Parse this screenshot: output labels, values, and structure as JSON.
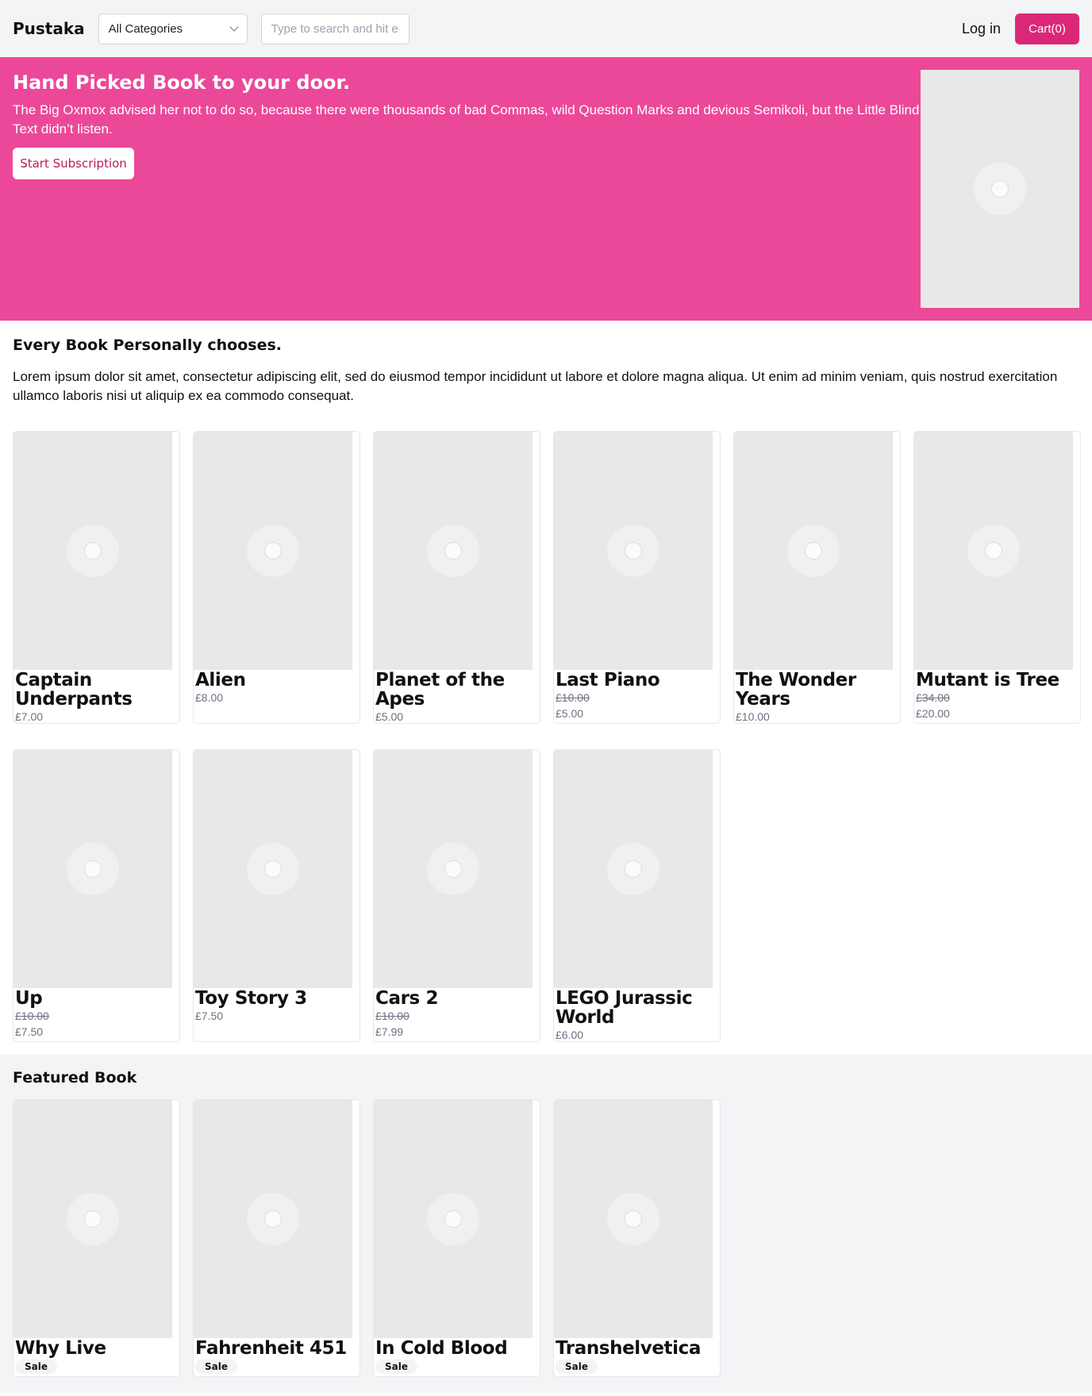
{
  "header": {
    "logo": "Pustaka",
    "category_select": "All Categories",
    "search_placeholder": "Type to search and hit enter",
    "login": "Log in",
    "cart": "Cart(0)"
  },
  "hero": {
    "title": "Hand Picked Book to your door.",
    "text": "The Big Oxmox advised her not to do so, because there were thousands of bad Commas, wild Question Marks and devious Semikoli, but the Little Blind Text didn’t listen.",
    "button": "Start Subscription"
  },
  "section": {
    "title": "Every Book Personally chooses.",
    "text": "Lorem ipsum dolor sit amet, consectetur adipiscing elit, sed do eiusmod tempor incididunt ut labore et dolore magna aliqua. Ut enim ad minim veniam, quis nostrud exercitation ullamco laboris nisi ut aliquip ex ea commodo consequat."
  },
  "books": [
    {
      "title": "Captain Underpants",
      "old_price": "",
      "price": "£7.00"
    },
    {
      "title": "Alien",
      "old_price": "",
      "price": "£8.00"
    },
    {
      "title": "Planet of the Apes",
      "old_price": "",
      "price": "£5.00"
    },
    {
      "title": "Last Piano",
      "old_price": "£10.00",
      "price": "£5.00"
    },
    {
      "title": "The Wonder Years",
      "old_price": "",
      "price": "£10.00"
    },
    {
      "title": "Mutant is Tree",
      "old_price": "£34.00",
      "price": "£20.00"
    },
    {
      "title": "Up",
      "old_price": "£10.00",
      "price": "£7.50"
    },
    {
      "title": "Toy Story 3",
      "old_price": "",
      "price": "£7.50"
    },
    {
      "title": "Cars 2",
      "old_price": "£10.00",
      "price": "£7.99"
    },
    {
      "title": "LEGO Jurassic World",
      "old_price": "",
      "price": "£6.00"
    }
  ],
  "featured": {
    "title": "Featured Book",
    "books": [
      {
        "title": "Why Live",
        "badge": "Sale"
      },
      {
        "title": "Fahrenheit 451",
        "badge": "Sale"
      },
      {
        "title": "In Cold Blood",
        "badge": "Sale"
      },
      {
        "title": "Transhelvetica",
        "badge": "Sale"
      }
    ]
  },
  "colors": {
    "accent": "#ec4899",
    "cart_button": "#db2777",
    "placeholder": "#e8e8e8"
  },
  "icons": {
    "image_placeholder": "image-placeholder-icon",
    "select_arrow": "chevron-down-icon"
  }
}
